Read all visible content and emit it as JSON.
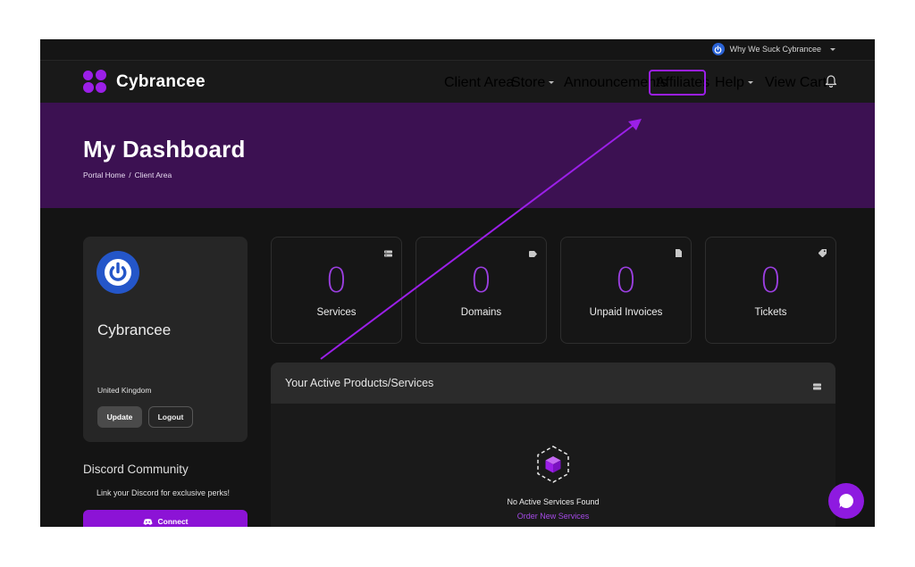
{
  "topbar": {
    "account_name": "Why We Suck Cybrancee"
  },
  "brand": {
    "name": "Cybrancee",
    "accent": "#9b1fe8"
  },
  "nav": {
    "items": [
      {
        "label": "Client Area",
        "dropdown": false
      },
      {
        "label": "Store",
        "dropdown": true
      },
      {
        "label": "Announcements",
        "dropdown": false
      },
      {
        "label": "Affiliates",
        "dropdown": false,
        "highlighted": true
      },
      {
        "label": "Help",
        "dropdown": true
      },
      {
        "label": "View Cart",
        "dropdown": false
      }
    ],
    "bell_icon": "bell-icon"
  },
  "hero": {
    "title": "My Dashboard",
    "breadcrumb": {
      "home": "Portal Home",
      "separator": "/",
      "current": "Client Area"
    },
    "background": "#3c1152"
  },
  "profile": {
    "name": "Cybrancee",
    "country": "United Kingdom",
    "update_label": "Update",
    "logout_label": "Logout"
  },
  "discord": {
    "title": "Discord Community",
    "text": "Link your Discord for exclusive perks!",
    "connect_label": "Connect"
  },
  "stats": [
    {
      "value": "0",
      "label": "Services",
      "icon": "server-icon"
    },
    {
      "value": "0",
      "label": "Domains",
      "icon": "tag-icon"
    },
    {
      "value": "0",
      "label": "Unpaid Invoices",
      "icon": "document-icon"
    },
    {
      "value": "0",
      "label": "Tickets",
      "icon": "ticket-icon"
    }
  ],
  "products": {
    "title": "Your Active Products/Services",
    "empty_text": "No Active Services Found",
    "empty_link": "Order New Services"
  },
  "chat": {
    "icon": "chat-icon"
  }
}
